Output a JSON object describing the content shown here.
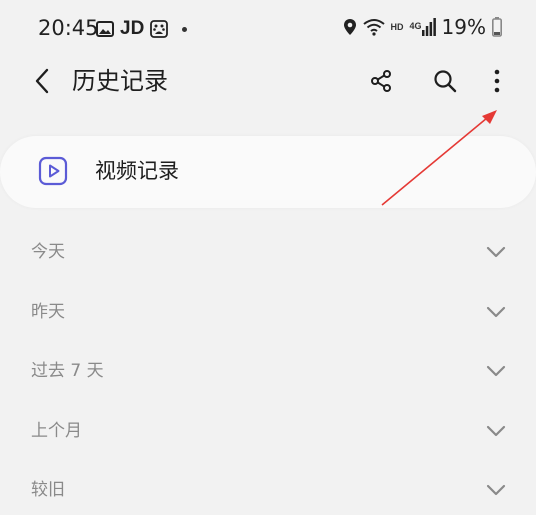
{
  "status_bar": {
    "time": "20:45",
    "jd_label": "JD",
    "hd_label": "HD",
    "network_label": "4G",
    "battery_percent": "19%"
  },
  "header": {
    "title": "历史记录"
  },
  "video_record": {
    "label": "视频记录",
    "accent_color": "#5b5bd6"
  },
  "sections": [
    {
      "label": "今天"
    },
    {
      "label": "昨天"
    },
    {
      "label": "过去 7 天"
    },
    {
      "label": "上个月"
    },
    {
      "label": "较旧"
    }
  ],
  "icons": {
    "back": "chevron-left-icon",
    "share": "share-icon",
    "search": "search-icon",
    "more": "more-vertical-icon",
    "video": "play-icon",
    "expand": "chevron-down-icon"
  },
  "annotation_color": "#e53935"
}
